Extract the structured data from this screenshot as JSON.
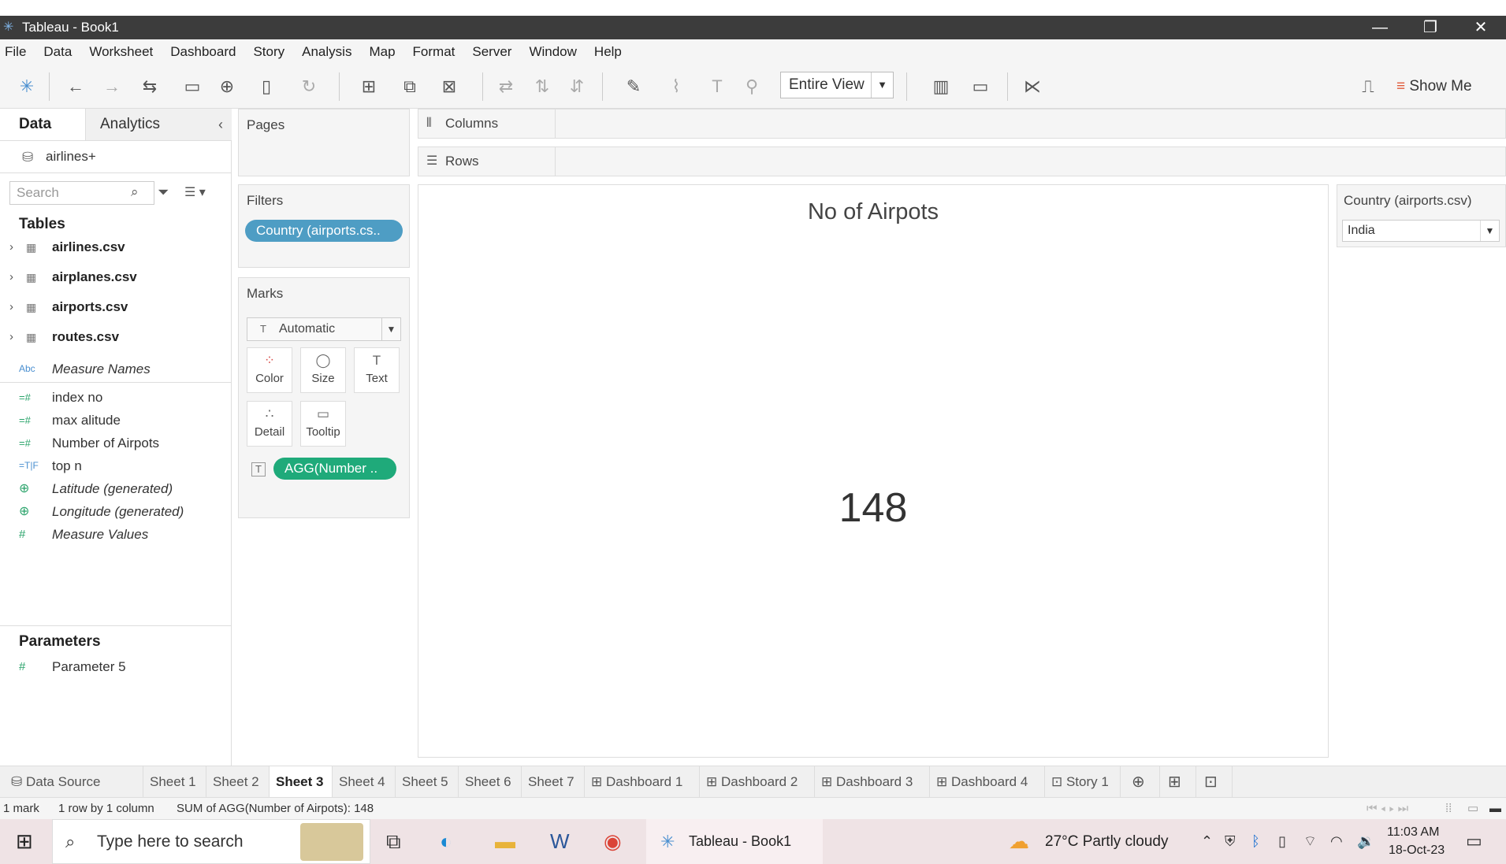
{
  "window": {
    "title": "Tableau - Book1",
    "minimize": "—",
    "restore": "❐",
    "close": "✕"
  },
  "menu": [
    "File",
    "Data",
    "Worksheet",
    "Dashboard",
    "Story",
    "Analysis",
    "Map",
    "Format",
    "Server",
    "Window",
    "Help"
  ],
  "toolbar": {
    "fit_label": "Entire View",
    "show_me": "Show Me"
  },
  "left_pane": {
    "tabs": {
      "data": "Data",
      "analytics": "Analytics"
    },
    "datasource": "airlines+",
    "search_placeholder": "Search",
    "tables_heading": "Tables",
    "tables": [
      "airlines.csv",
      "airplanes.csv",
      "airports.csv",
      "routes.csv"
    ],
    "measure_names": {
      "icon": "Abc",
      "label": "Measure Names"
    },
    "fields": [
      {
        "icon": "=#",
        "label": "index no"
      },
      {
        "icon": "=#",
        "label": "max alitude"
      },
      {
        "icon": "=#",
        "label": "Number of Airpots"
      },
      {
        "icon": "=T|F",
        "label": "top n"
      },
      {
        "icon": "globe-icon",
        "label": "Latitude (generated)"
      },
      {
        "icon": "globe-icon",
        "label": "Longitude (generated)"
      },
      {
        "icon": "#",
        "label": "Measure Values"
      }
    ],
    "parameters_heading": "Parameters",
    "parameters": [
      {
        "icon": "#",
        "label": "Parameter 5"
      }
    ]
  },
  "cards": {
    "pages": "Pages",
    "filters": "Filters",
    "filter_pill": "Country (airports.cs..",
    "marks": "Marks",
    "mark_type": "Automatic",
    "mark_buttons": [
      "Color",
      "Size",
      "Text",
      "Detail",
      "Tooltip"
    ],
    "text_pill": "AGG(Number .."
  },
  "shelves": {
    "columns": "Columns",
    "rows": "Rows"
  },
  "view": {
    "title": "No of Airpots",
    "value": "148"
  },
  "quick_filter": {
    "title": "Country (airports.csv)",
    "value": "India"
  },
  "sheet_tabs": [
    {
      "label": "Data Source"
    },
    {
      "label": "Sheet 1"
    },
    {
      "label": "Sheet 2"
    },
    {
      "label": "Sheet 3",
      "active": true
    },
    {
      "label": "Sheet 4"
    },
    {
      "label": "Sheet 5"
    },
    {
      "label": "Sheet 6"
    },
    {
      "label": "Sheet 7"
    },
    {
      "label": "Dashboard 1"
    },
    {
      "label": "Dashboard 2"
    },
    {
      "label": "Dashboard 3"
    },
    {
      "label": "Dashboard 4"
    },
    {
      "label": "Story 1"
    }
  ],
  "status": {
    "marks": "1 mark",
    "dims": "1 row by 1 column",
    "sum": "SUM of AGG(Number of Airpots): 148"
  },
  "taskbar": {
    "search_placeholder": "Type here to search",
    "active_app": "Tableau - Book1",
    "weather": "27°C  Partly cloudy",
    "time": "11:03 AM",
    "date": "18-Oct-23"
  },
  "colors": {
    "filter_pill": "#4e9dc4",
    "measure_pill": "#1faa7a",
    "titlebar": "#3c3c3c",
    "taskbar": "#efe3e5"
  }
}
